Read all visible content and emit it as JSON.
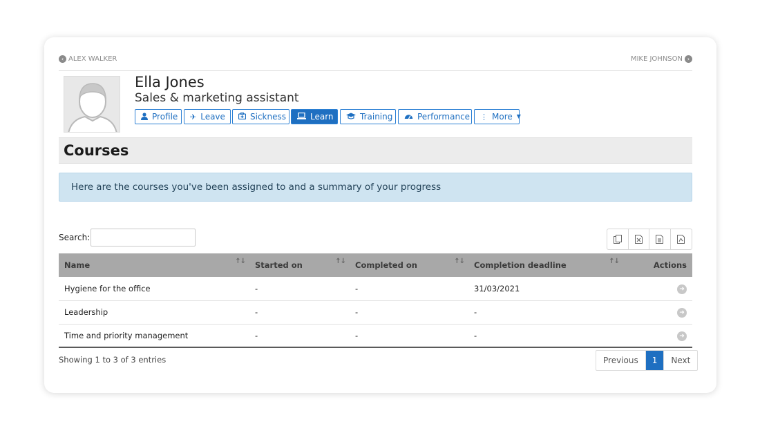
{
  "nav": {
    "prev_label": "ALEX WALKER",
    "next_label": "MIKE JOHNSON"
  },
  "employee": {
    "name": "Ella Jones",
    "role": "Sales & marketing assistant"
  },
  "tabs": [
    {
      "label": "Profile",
      "icon": "user-icon"
    },
    {
      "label": "Leave",
      "icon": "plane-icon"
    },
    {
      "label": "Sickness",
      "icon": "medkit-icon"
    },
    {
      "label": "Learn",
      "icon": "laptop-icon",
      "active": true
    },
    {
      "label": "Training",
      "icon": "graduation-cap-icon"
    },
    {
      "label": "Performance",
      "icon": "gauge-icon"
    },
    {
      "label": "More",
      "icon": "vertical-dots-icon"
    }
  ],
  "section": {
    "title": "Courses"
  },
  "alert": {
    "text": "Here are the courses you've been assigned to and a summary of your progress"
  },
  "search": {
    "label": "Search:",
    "value": "",
    "placeholder": ""
  },
  "export_buttons": [
    "copy-icon",
    "excel-icon",
    "csv-icon",
    "pdf-icon"
  ],
  "table": {
    "columns": [
      "Name",
      "Started on",
      "Completed on",
      "Completion deadline",
      "Actions"
    ],
    "rows": [
      {
        "name": "Hygiene for the office",
        "started": "-",
        "completed": "-",
        "deadline": "31/03/2021"
      },
      {
        "name": "Leadership",
        "started": "-",
        "completed": "-",
        "deadline": "-"
      },
      {
        "name": "Time and priority management",
        "started": "-",
        "completed": "-",
        "deadline": "-"
      }
    ]
  },
  "footer": {
    "info": "Showing 1 to 3 of 3 entries",
    "prev": "Previous",
    "page": "1",
    "next": "Next"
  },
  "colors": {
    "accent": "#1e6fc1",
    "alert_bg": "#cfe4f1",
    "header_bg": "#a8a8a8"
  }
}
